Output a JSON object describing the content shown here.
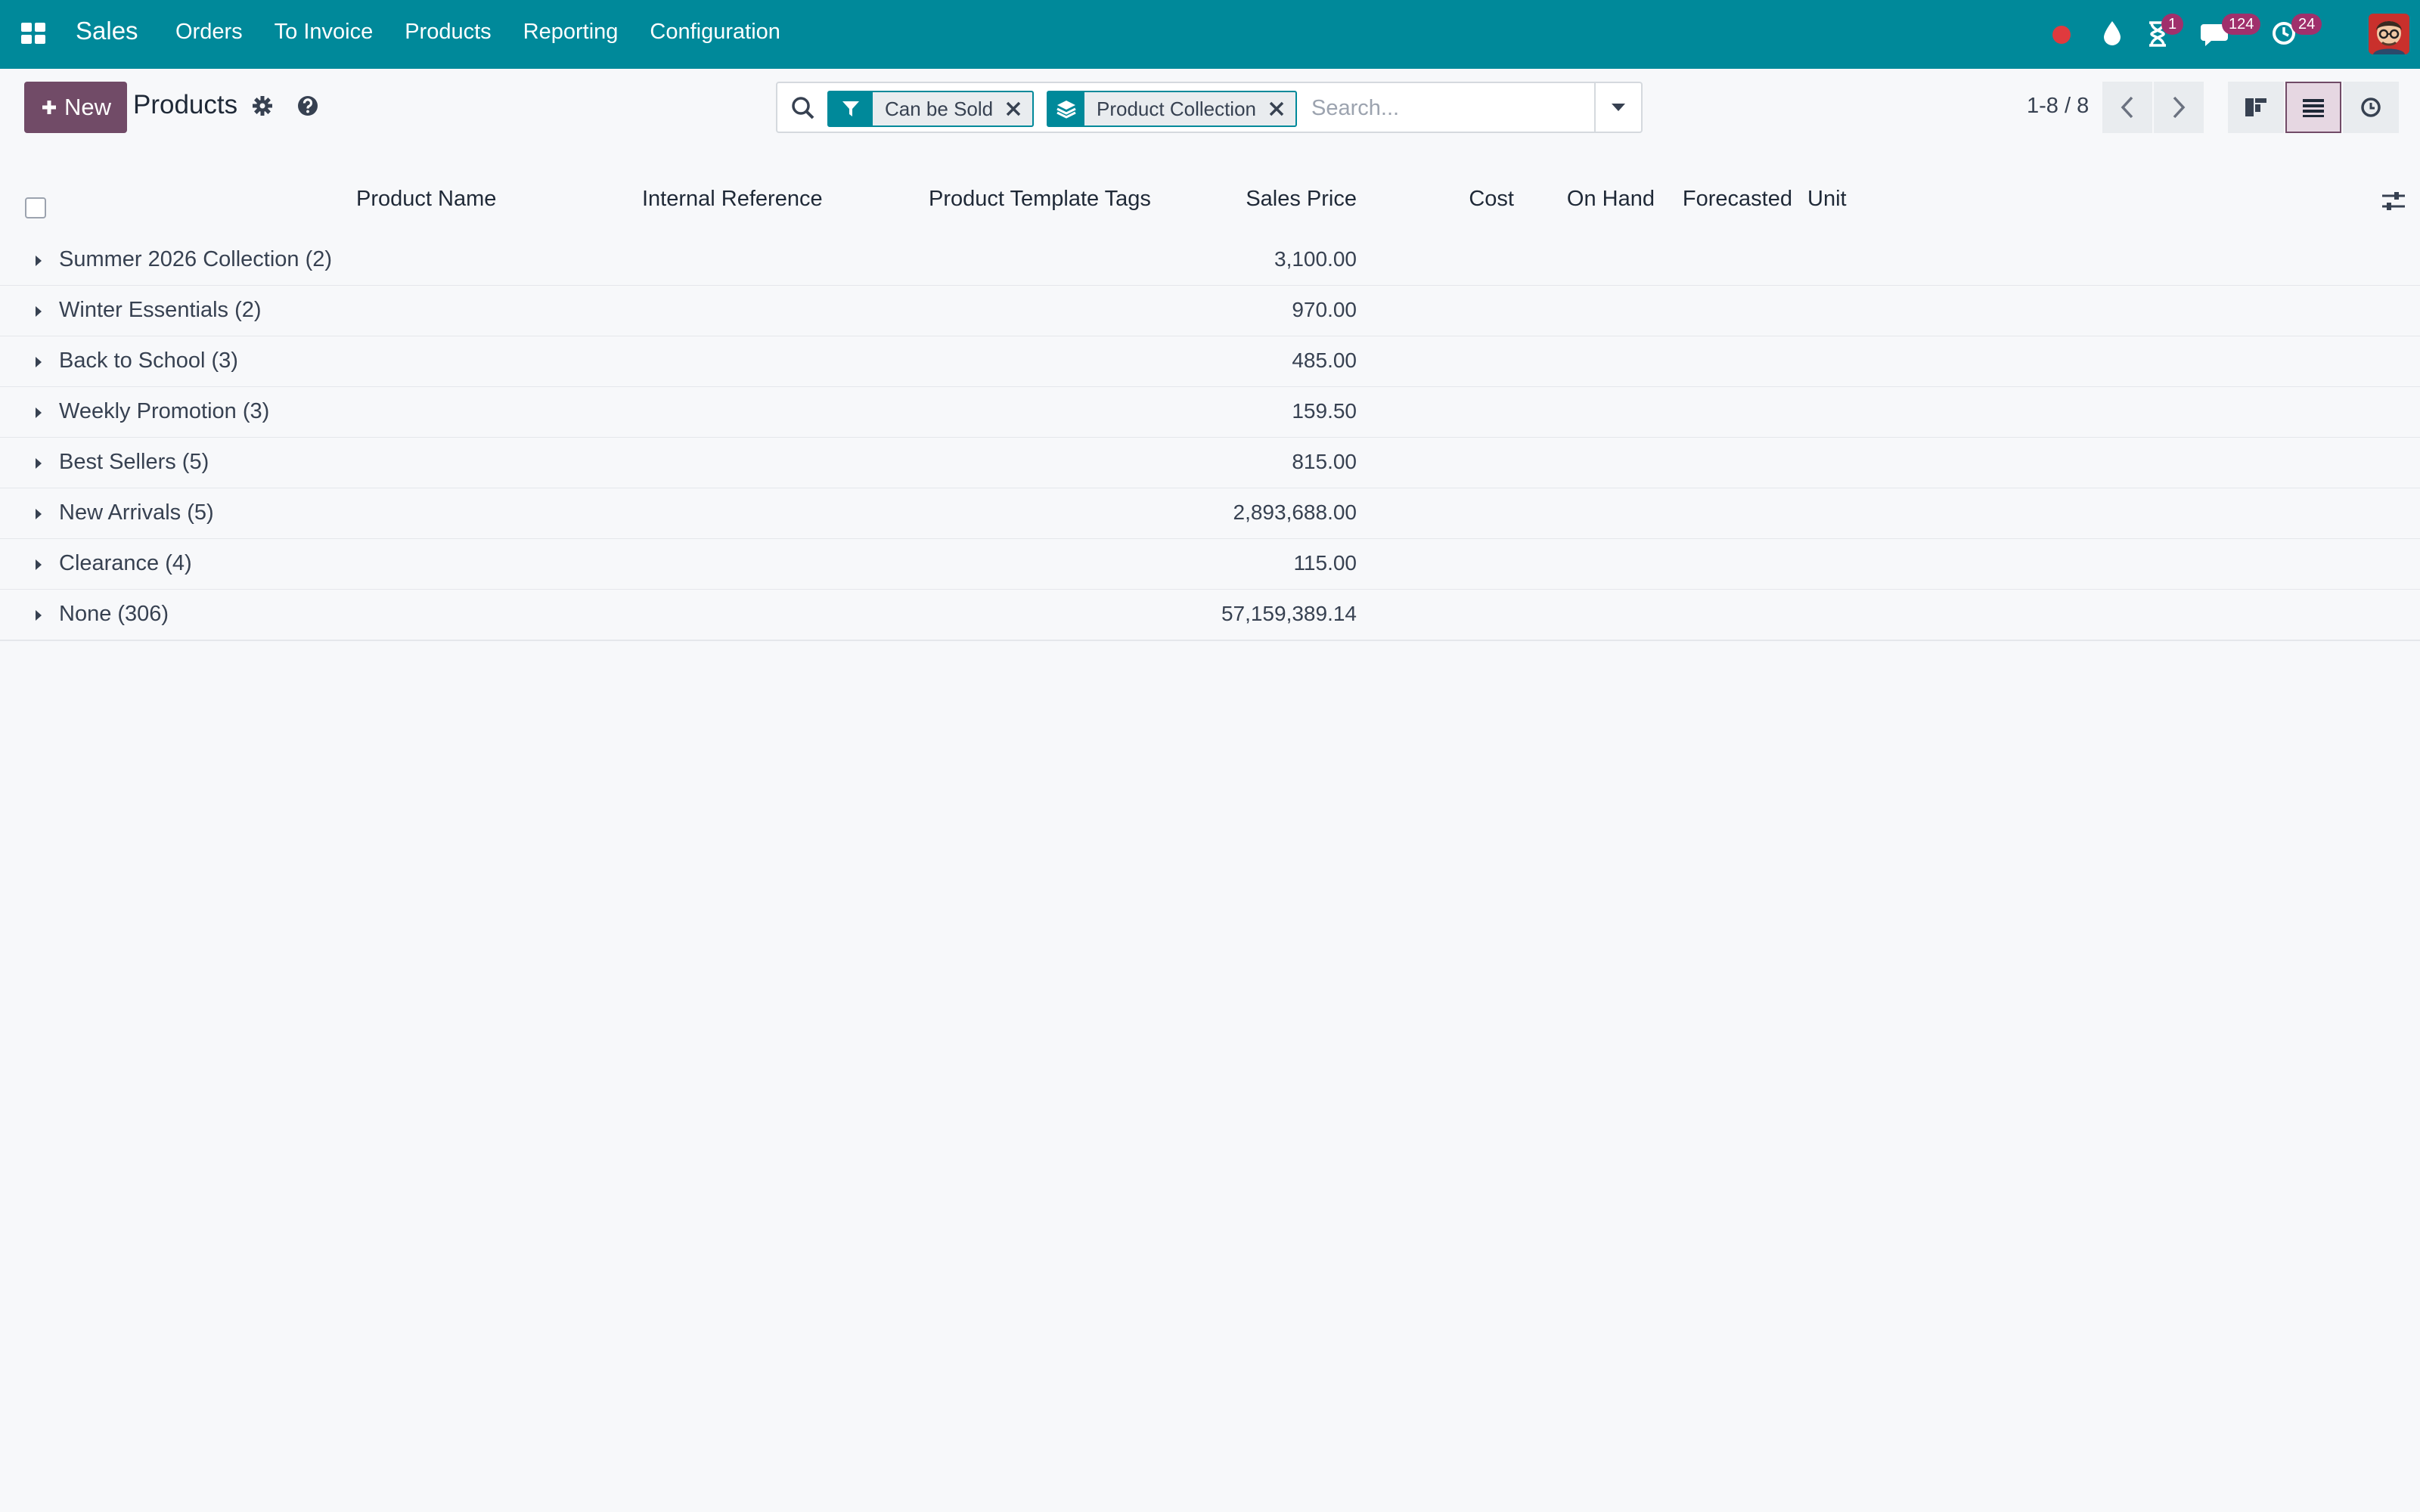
{
  "app": {
    "name": "Sales",
    "menu": [
      "Orders",
      "To Invoice",
      "Products",
      "Reporting",
      "Configuration"
    ]
  },
  "systray": {
    "activities_badge": "1",
    "messages_badge": "124",
    "updates_badge": "24",
    "icons": [
      "recording-dot-icon",
      "droplet-icon",
      "hourglass-icon",
      "chat-icon",
      "clock-refresh-icon",
      "user-avatar"
    ]
  },
  "control_panel": {
    "new_label": "New",
    "title": "Products",
    "search": {
      "facets": [
        {
          "icon": "filter-icon",
          "label": "Can be Sold"
        },
        {
          "icon": "layers-icon",
          "label": "Product Collection"
        }
      ],
      "placeholder": "Search..."
    },
    "pager": "1-8 / 8",
    "views": [
      "kanban-view-icon",
      "list-view-icon",
      "activity-view-icon"
    ],
    "active_view": "list"
  },
  "list": {
    "columns": {
      "product_name": "Product Name",
      "internal_reference": "Internal Reference",
      "tags": "Product Template Tags",
      "sales_price": "Sales Price",
      "cost": "Cost",
      "on_hand": "On Hand",
      "forecasted": "Forecasted",
      "unit": "Unit"
    },
    "groups": [
      {
        "name": "Summer 2026 Collection (2)",
        "sales_price": "3,100.00"
      },
      {
        "name": "Winter Essentials (2)",
        "sales_price": "970.00"
      },
      {
        "name": "Back to School (3)",
        "sales_price": "485.00"
      },
      {
        "name": "Weekly Promotion (3)",
        "sales_price": "159.50"
      },
      {
        "name": "Best Sellers (5)",
        "sales_price": "815.00"
      },
      {
        "name": "New Arrivals (5)",
        "sales_price": "2,893,688.00"
      },
      {
        "name": "Clearance (4)",
        "sales_price": "115.00"
      },
      {
        "name": "None (306)",
        "sales_price": "57,159,389.14"
      }
    ]
  },
  "colors": {
    "navbar": "#00899a",
    "primary_button": "#714b67",
    "badge": "#a0306c",
    "record_dot": "#e03a3e"
  }
}
